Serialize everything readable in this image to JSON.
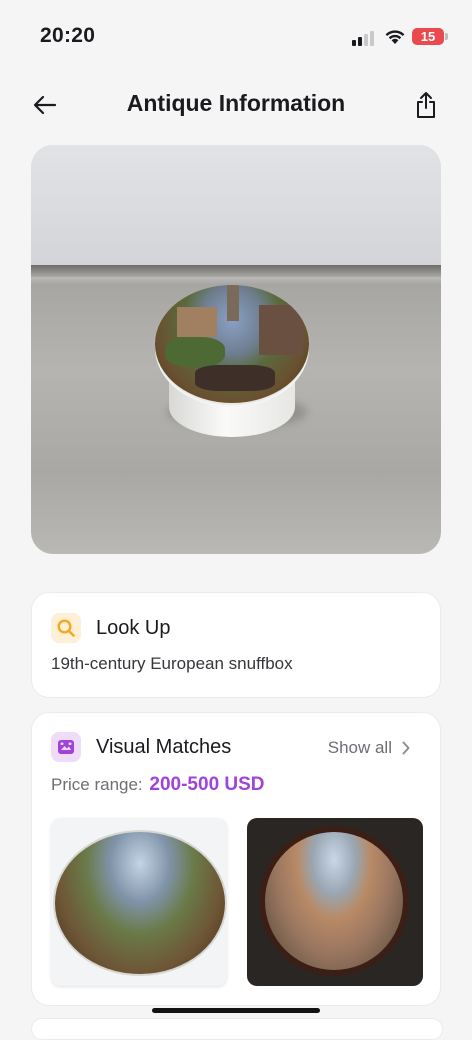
{
  "status_bar": {
    "time": "20:20",
    "battery": "15"
  },
  "nav": {
    "title": "Antique Information",
    "back_icon": "arrow-left-icon",
    "share_icon": "share-icon"
  },
  "hero": {
    "icon": "antique-photo"
  },
  "lookup": {
    "title": "Look Up",
    "text": "19th-century European snuffbox",
    "icon": "search-icon",
    "icon_color": "#f5a623"
  },
  "visual_matches": {
    "title": "Visual Matches",
    "show_all": "Show all",
    "price_label": "Price range:",
    "price_value": "200-500 USD",
    "icon": "image-match-icon",
    "accent": "#a043d8"
  },
  "colors": {
    "accent": "#a043d8",
    "lookup_icon_bg": "#fdf0d6",
    "matches_icon_bg": "#eedcf9",
    "battery": "#e9494f"
  }
}
